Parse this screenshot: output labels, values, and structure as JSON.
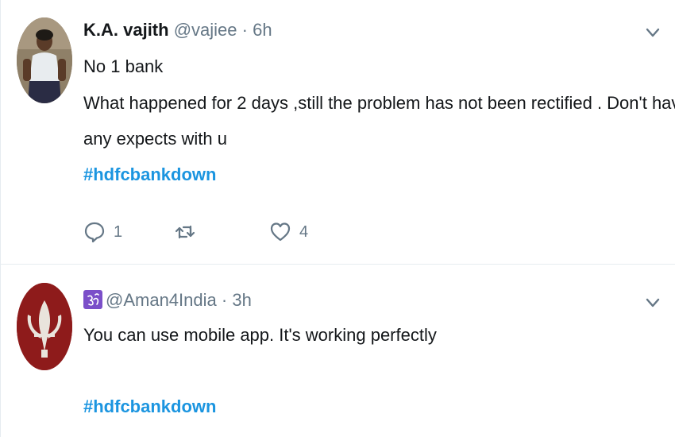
{
  "tweets": [
    {
      "display_name": "K.A. vajith",
      "handle": "@vajiee",
      "separator": "·",
      "time": "6h",
      "lines": [
        "No 1 bank",
        "What happened for 2 days ,still the problem has not been rectified . Don't have",
        "any expects with u"
      ],
      "hashtag": "#hdfcbankdown",
      "actions": {
        "reply_count": "1",
        "retweet_count": "",
        "like_count": "4"
      }
    },
    {
      "handle": "@Aman4India",
      "separator": "·",
      "time": "3h",
      "lines": [
        "You can use mobile app. It's working perfectly"
      ],
      "hashtag": "#hdfcbankdown"
    }
  ],
  "icons": {
    "menu": "chevron-down-icon",
    "reply": "reply-icon",
    "retweet": "retweet-icon",
    "like": "heart-icon",
    "badge": "om-icon"
  },
  "colors": {
    "hashtag": "#1b95e0",
    "text": "#14171a",
    "secondary": "#657786",
    "divider": "#e6ecf0",
    "badge": "#7b4fc9"
  }
}
